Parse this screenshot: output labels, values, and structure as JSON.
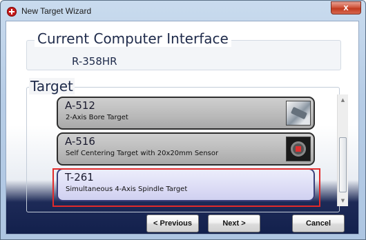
{
  "window": {
    "title": "New Target Wizard",
    "close_label": "x"
  },
  "current_interface": {
    "heading": "Current Computer Interface",
    "value": "R-358HR"
  },
  "target": {
    "heading": "Target",
    "items": [
      {
        "name": "A-512",
        "description": "2-Axis Bore Target",
        "icon": "bore-target-icon",
        "selected": false
      },
      {
        "name": "A-516",
        "description": "Self Centering Target with 20x20mm Sensor",
        "icon": "sensor-target-icon",
        "selected": false
      },
      {
        "name": "T-261",
        "description": "Simultaneous 4-Axis Spindle Target",
        "icon": "",
        "selected": true
      }
    ]
  },
  "buttons": {
    "previous": "< Previous",
    "next": "Next >",
    "cancel": "Cancel"
  },
  "colors": {
    "selection_outline": "#e22a2a",
    "footer_background": "#12204c"
  }
}
